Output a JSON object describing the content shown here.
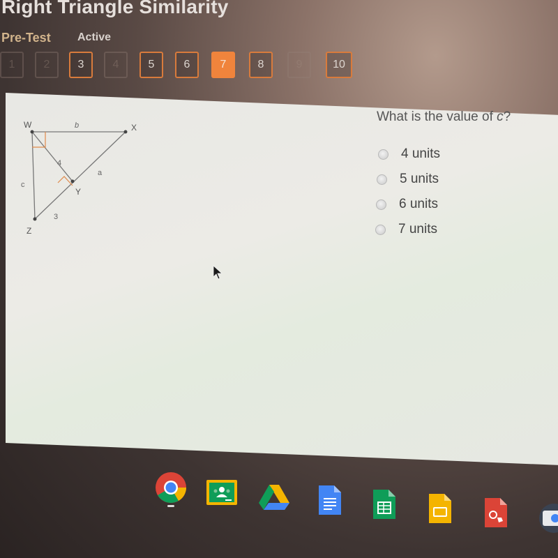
{
  "header": {
    "title": "Right Triangle Similarity",
    "section": "Pre-Test",
    "status": "Active"
  },
  "question_nav": [
    {
      "label": "1",
      "state": "disabled"
    },
    {
      "label": "2",
      "state": "disabled"
    },
    {
      "label": "3",
      "state": "available"
    },
    {
      "label": "4",
      "state": "disabled"
    },
    {
      "label": "5",
      "state": "available"
    },
    {
      "label": "6",
      "state": "available"
    },
    {
      "label": "7",
      "state": "current"
    },
    {
      "label": "8",
      "state": "available"
    },
    {
      "label": "9",
      "state": "disabled"
    },
    {
      "label": "10",
      "state": "available"
    }
  ],
  "diagram": {
    "vertices": {
      "W": "W",
      "X": "X",
      "Y": "Y",
      "Z": "Z"
    },
    "labels": {
      "b": "b",
      "a": "a",
      "c": "c",
      "wy": "4",
      "yz": "3"
    },
    "right_angle_color": "#e08a4a"
  },
  "question": {
    "prefix": "What is the value of ",
    "variable": "c",
    "suffix": "?"
  },
  "choices": [
    {
      "label": "4 units",
      "selected": false
    },
    {
      "label": "5 units",
      "selected": false
    },
    {
      "label": "6 units",
      "selected": false
    },
    {
      "label": "7 units",
      "selected": false
    }
  ],
  "shelf": {
    "apps": [
      {
        "name": "Chrome",
        "icon": "chrome-icon",
        "active": true
      },
      {
        "name": "Google Classroom",
        "icon": "classroom-icon"
      },
      {
        "name": "Google Drive",
        "icon": "drive-icon"
      },
      {
        "name": "Google Docs",
        "icon": "docs-icon"
      },
      {
        "name": "Google Sheets",
        "icon": "sheets-icon"
      },
      {
        "name": "Google Slides",
        "icon": "slides-icon"
      },
      {
        "name": "Google Drawings",
        "icon": "drawings-icon"
      },
      {
        "name": "Camera",
        "icon": "camera-icon"
      }
    ]
  },
  "colors": {
    "accent": "#f0843c",
    "section": "#d2b48c"
  }
}
